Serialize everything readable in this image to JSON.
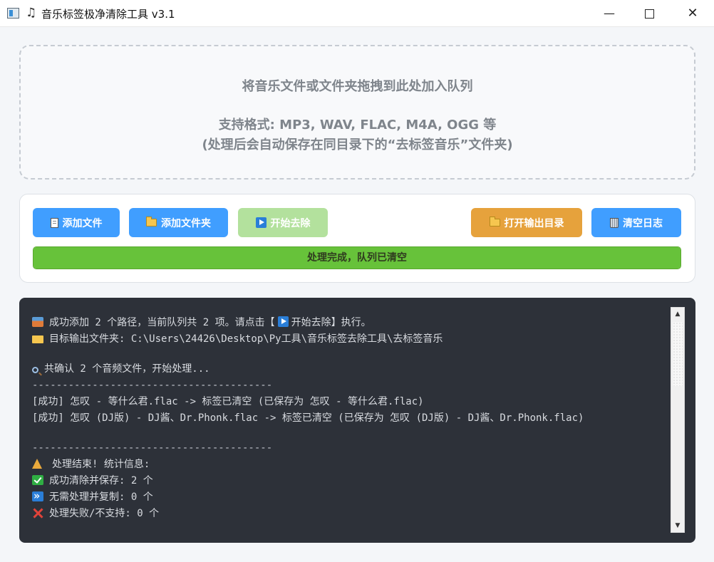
{
  "window": {
    "title": "音乐标签极净清除工具 v3.1",
    "title_icon_glyph": "♫",
    "minimize_glyph": "—",
    "close_glyph": "✕"
  },
  "dropzone": {
    "line1": "将音乐文件或文件夹拖拽到此处加入队列",
    "line2": "支持格式: MP3, WAV, FLAC, M4A, OGG 等",
    "line3": "(处理后会自动保存在同目录下的“去标签音乐”文件夹)"
  },
  "toolbar": {
    "add_file": "添加文件",
    "add_folder": "添加文件夹",
    "start": "开始去除",
    "open_output": "打开输出目录",
    "clear_log": "清空日志"
  },
  "progress": {
    "text": "处理完成，队列已清空",
    "value": 1.0
  },
  "log": {
    "l1_pre": "成功添加 2 个路径，当前队列共 2 项。请点击【",
    "l1_post": "开始去除】执行。",
    "l2": "目标输出文件夹: C:\\Users\\24426\\Desktop\\Py工具\\音乐标签去除工具\\去标签音乐",
    "l3": "共确认 2 个音频文件，开始处理...",
    "sep": "----------------------------------------",
    "l4": "[成功] 怎叹 - 等什么君.flac -> 标签已清空 (已保存为 怎叹 - 等什么君.flac)",
    "l5": "[成功] 怎叹 (DJ版) - DJ酱、Dr.Phonk.flac -> 标签已清空 (已保存为 怎叹 (DJ版) - DJ酱、Dr.Phonk.flac)",
    "l6": "处理结束! 统计信息:",
    "l7": "成功清除并保存: 2 个",
    "l8": "无需处理并复制: 0 个",
    "l9": "处理失败/不支持: 0 个"
  },
  "colors": {
    "primary": "#409eff",
    "warning": "#e6a23c",
    "success": "#67c23a",
    "disabled_success": "#b3e19d",
    "log_bg": "#2d3139"
  }
}
